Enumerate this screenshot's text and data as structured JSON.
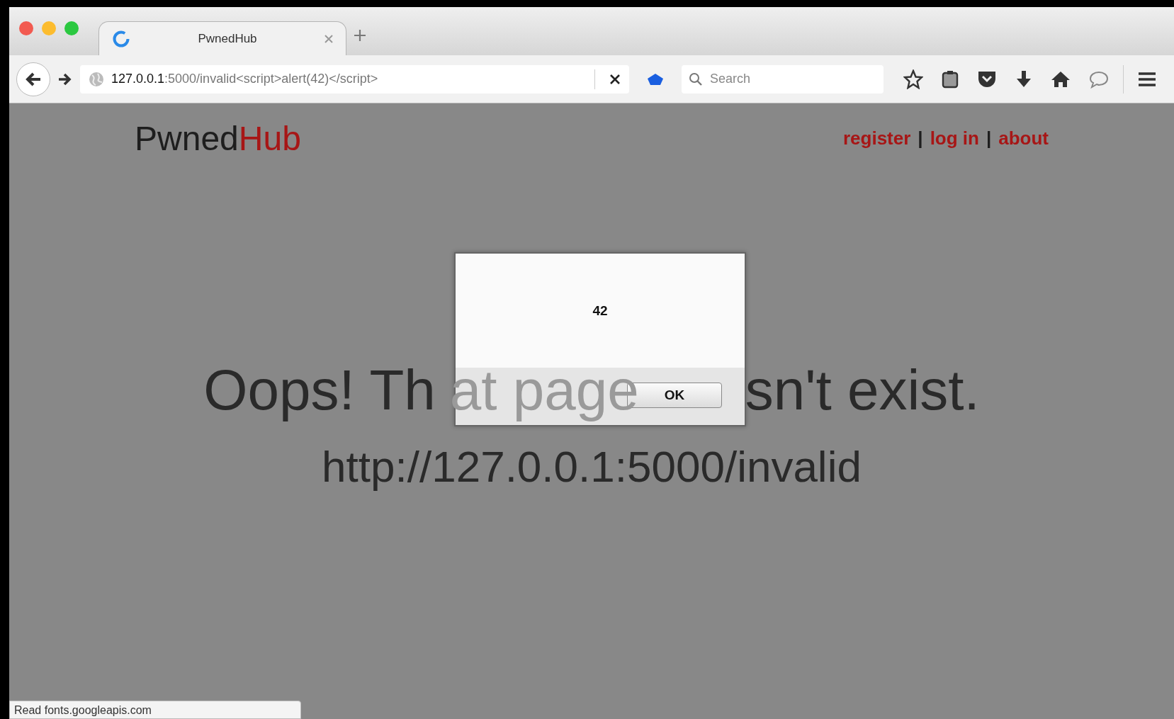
{
  "tab": {
    "title": "PwnedHub",
    "selected": true
  },
  "address_bar": {
    "host": "127.0.0.1",
    "rest": ":5000/invalid<script>alert(42)</script>"
  },
  "search": {
    "placeholder": "Search"
  },
  "site": {
    "logo_dark": "Pwned",
    "logo_red": "Hub",
    "nav": [
      {
        "label": "register"
      },
      {
        "label": "log in"
      },
      {
        "label": "about"
      }
    ],
    "separator": "|"
  },
  "heading": {
    "left": "Oops! Th",
    "under_dialog": "at page",
    "right": "sn't exist."
  },
  "page_url": "http://127.0.0.1:5000/invalid",
  "alert": {
    "message": "42",
    "button": "OK"
  },
  "status_bar": "Read fonts.googleapis.com"
}
